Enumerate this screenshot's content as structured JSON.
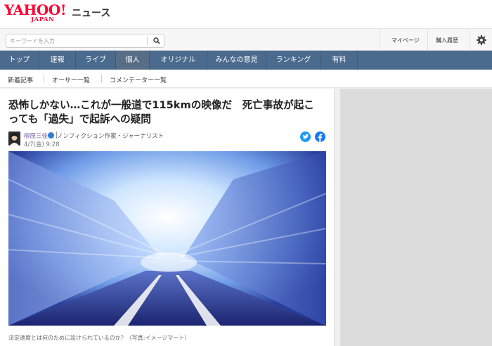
{
  "header": {
    "logo_text": "YAHOO!",
    "logo_sub": "JAPAN",
    "service": "ニュース",
    "mypage": "マイページ",
    "history": "購入履歴"
  },
  "search": {
    "placeholder": "キーワードを入力"
  },
  "nav": {
    "items": [
      {
        "label": "トップ"
      },
      {
        "label": "速報"
      },
      {
        "label": "ライブ"
      },
      {
        "label": "個人"
      },
      {
        "label": "オリジナル"
      },
      {
        "label": "みんなの意見"
      },
      {
        "label": "ランキング"
      },
      {
        "label": "有料"
      }
    ]
  },
  "subnav": {
    "items": [
      {
        "label": "新着記事"
      },
      {
        "label": "オーサー一覧"
      },
      {
        "label": "コメンテーター一覧"
      }
    ]
  },
  "article": {
    "title_line1": "恐怖しかない…これが一般道で115kmの映像だ　死亡事故が起こ",
    "title_line2": "っても「過失」で起訴への疑問",
    "author": "柳原三佳",
    "author_desc": "ノンフィクション作家・ジャーナリスト",
    "date": "4/7(金) 9:28",
    "caption": "法定速度とは何のために設けられているのか？（写真:イメージマート）"
  },
  "colors": {
    "brand": "#ff0033",
    "nav": "#4a6a8e",
    "twitter": "#1d9bf0",
    "facebook": "#1877f2"
  }
}
